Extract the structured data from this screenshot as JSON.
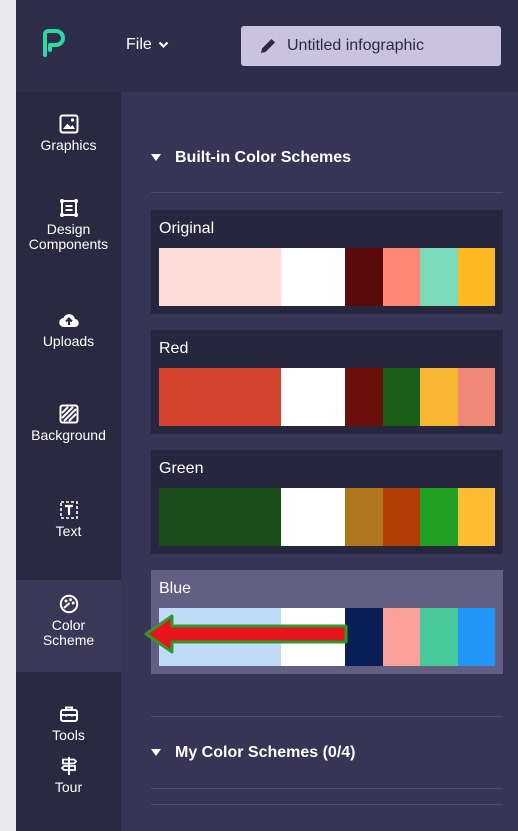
{
  "topbar": {
    "file_label": "File",
    "title_label": "Untitled infographic"
  },
  "sidebar": {
    "items": [
      {
        "label": "Graphics",
        "icon": "image-icon"
      },
      {
        "label": "Design Components",
        "icon": "components-icon"
      },
      {
        "label": "Uploads",
        "icon": "cloud-upload-icon"
      },
      {
        "label": "Background",
        "icon": "background-pattern-icon"
      },
      {
        "label": "Text",
        "icon": "text-box-icon"
      },
      {
        "label": "Color Scheme",
        "icon": "palette-icon",
        "active": true
      },
      {
        "label": "Tools",
        "icon": "toolbox-icon"
      },
      {
        "label": "Tour",
        "icon": "signpost-icon"
      }
    ]
  },
  "panel": {
    "builtin_heading": "Built-in Color Schemes",
    "my_heading": "My Color Schemes (0/4)",
    "schemes": [
      {
        "name": "Original",
        "colors": [
          "#fddcd7",
          "#ffffff",
          "#5a0a0a",
          "#fe8875",
          "#79dbb9",
          "#fdb921"
        ]
      },
      {
        "name": "Red",
        "colors": [
          "#d3432d",
          "#ffffff",
          "#6b0f0b",
          "#1b5e17",
          "#f6b631",
          "#ef8876"
        ]
      },
      {
        "name": "Green",
        "colors": [
          "#1b4d1a",
          "#ffffff",
          "#b2761c",
          "#b23d05",
          "#22a223",
          "#fdbd32"
        ]
      },
      {
        "name": "Blue",
        "colors": [
          "#bfdbf8",
          "#ffffff",
          "#0a1f55",
          "#fba099",
          "#48c99b",
          "#2196f8"
        ],
        "selected": true
      }
    ]
  },
  "colors": {
    "brand_accent": "#2fd9a3",
    "annotation_arrow": "#e8141b"
  }
}
